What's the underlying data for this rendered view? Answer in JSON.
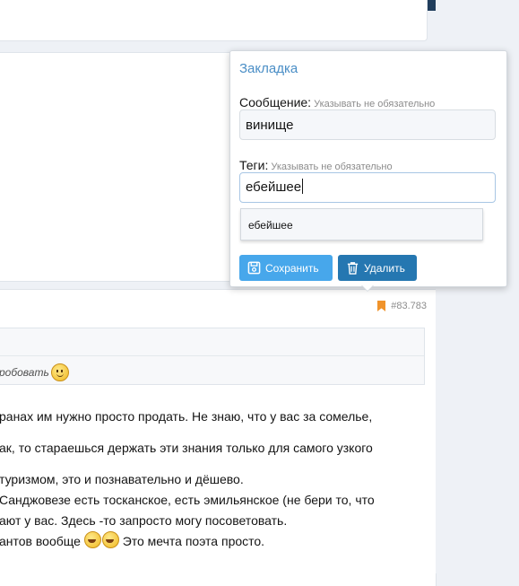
{
  "popup": {
    "title": "Закладка",
    "message_label": "Сообщение:",
    "message_hint": "Указывать не обязательно",
    "message_value": "винище",
    "tags_label": "Теги:",
    "tags_hint": "Указывать не обязательно",
    "tags_value": "ебейшее",
    "suggestion": "ебейшее",
    "save_label": "Сохранить",
    "delete_label": "Удалить"
  },
  "post": {
    "number": "#83.783",
    "quote_fragment": "робовать",
    "lines": [
      "ранах им нужно просто продать. Не знаю, что у вас за сомелье,",
      "ак, то стараешься держать эти знания только для самого узкого",
      "туризмом, это и познавательно и дёшево.",
      "Санджовезе есть тосканское, есть эмильянское (не бери то, что",
      "ают у вас. Здесь -то запросто могу посоветовать.",
      "антов вообще",
      "Это мечта поэта просто."
    ]
  },
  "colors": {
    "accent": "#47a7eb",
    "delete": "#2577b1",
    "title": "#4a8ec6",
    "bookmark": "#f0932b",
    "nav": "#2b4e72"
  }
}
